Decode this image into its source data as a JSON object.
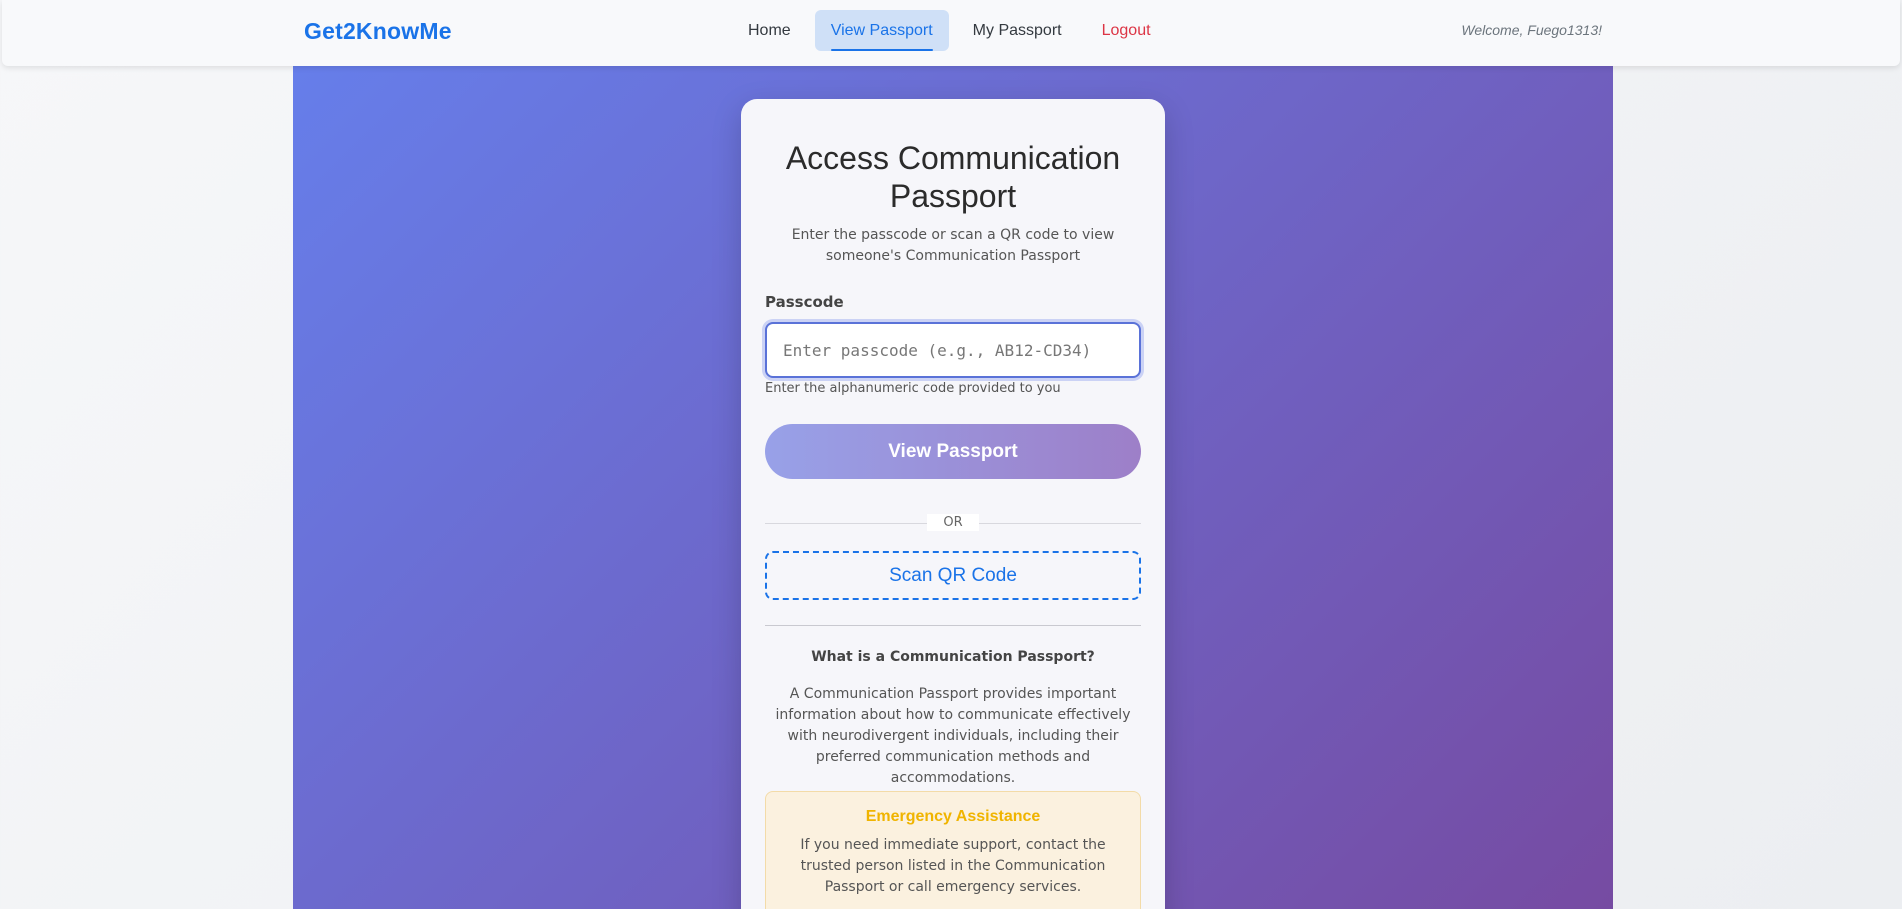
{
  "header": {
    "brand": "Get2KnowMe",
    "nav": [
      {
        "label": "Home"
      },
      {
        "label": "View Passport"
      },
      {
        "label": "My Passport"
      },
      {
        "label": "Logout"
      }
    ],
    "welcome": "Welcome, Fuego1313!"
  },
  "card": {
    "title": "Access Communication Passport",
    "subtitle": "Enter the passcode or scan a QR code to view someone's Communication Passport",
    "passcode_label": "Passcode",
    "passcode_value": "",
    "passcode_placeholder": "Enter passcode (e.g., AB12-CD34)",
    "passcode_help": "Enter the alphanumeric code provided to you",
    "view_button": "View Passport",
    "or_text": "OR",
    "scan_button": "Scan QR Code",
    "info_title": "What is a Communication Passport?",
    "info_text": "A Communication Passport provides important information about how to communicate effectively with neurodivergent individuals, including their preferred communication methods and accommodations.",
    "emergency_title": "Emergency Assistance",
    "emergency_text": "If you need immediate support, contact the trusted person listed in the Communication Passport or call emergency services."
  },
  "colors": {
    "brand": "#1a73e8",
    "logout": "#dc3545",
    "gradient_start": "#667eea",
    "gradient_end": "#764ba2",
    "emergency": "#f0b400"
  }
}
